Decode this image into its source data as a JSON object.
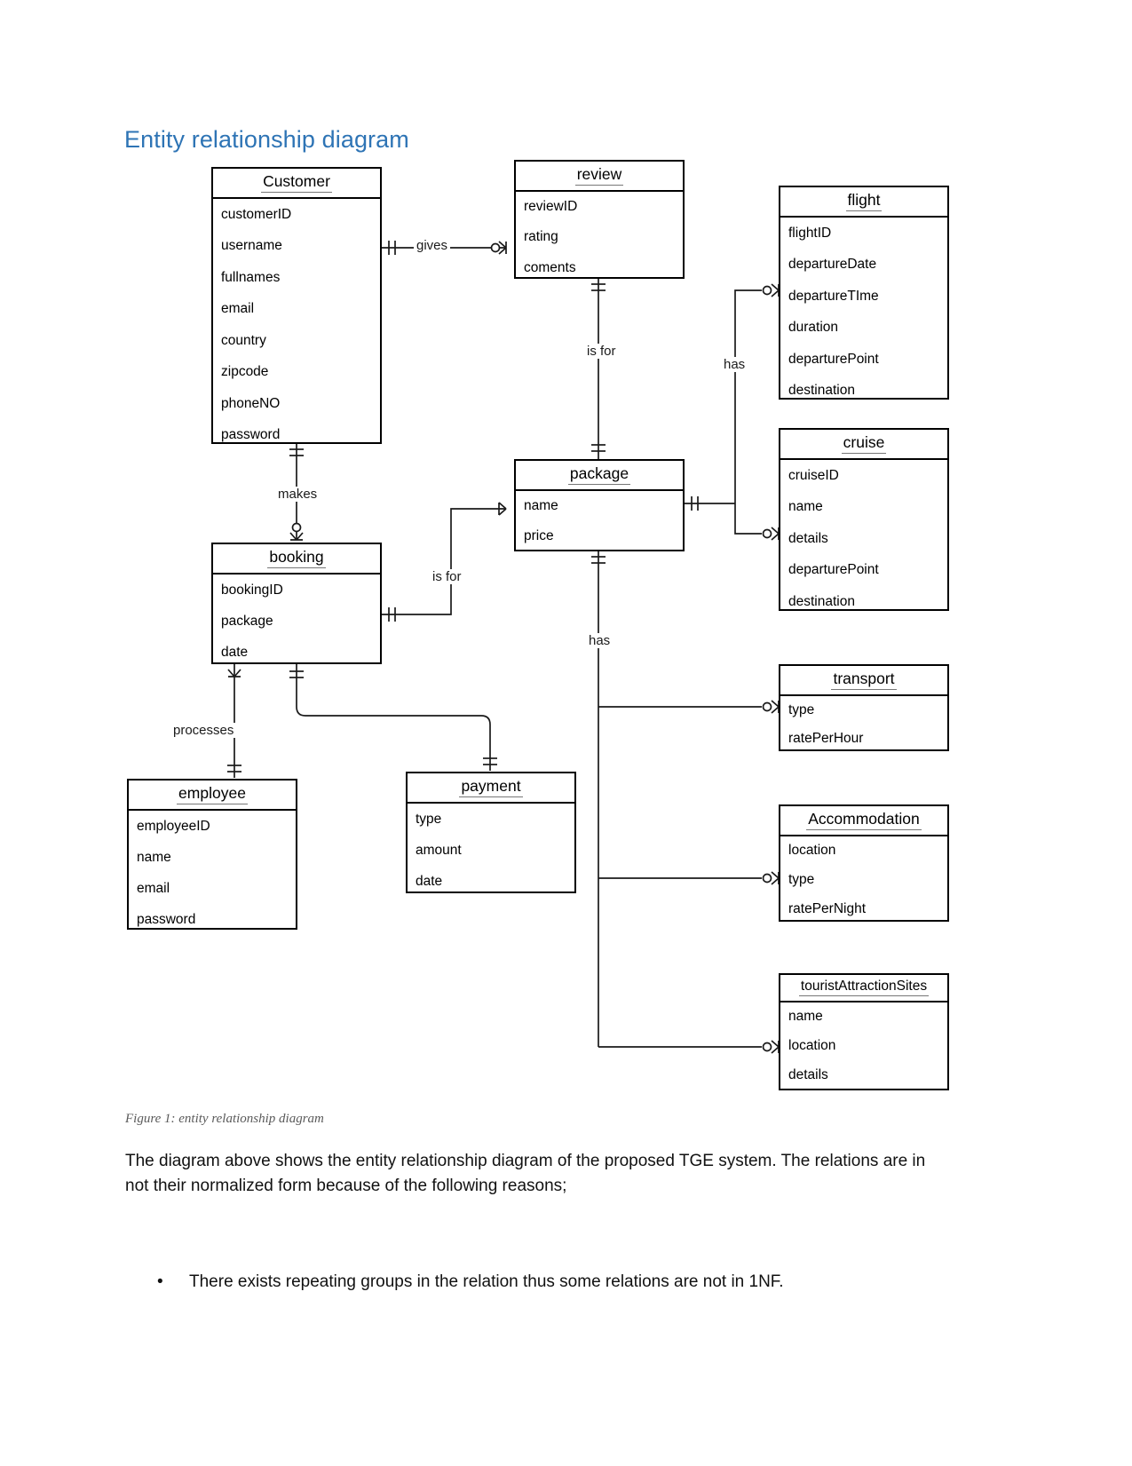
{
  "document": {
    "heading": "Entity relationship diagram",
    "figure_caption": "Figure 1: entity relationship diagram",
    "paragraph": "The diagram above shows the entity relationship diagram of the proposed TGE system. The relations are in not their normalized form because of the following reasons;",
    "bullets": [
      {
        "marker": "•",
        "text": "There exists repeating groups in the relation thus some relations are not in 1NF."
      }
    ],
    "heading_color": "#2E74B5",
    "caption_color": "#5a5a5a"
  },
  "diagram": {
    "type": "entity-relationship",
    "notation": "crows-foot",
    "entities": [
      {
        "id": "customer",
        "title": "Customer",
        "attributes": [
          "customerID",
          "username",
          "fullnames",
          "email",
          "country",
          "zipcode",
          "phoneNO",
          "password"
        ]
      },
      {
        "id": "review",
        "title": "review",
        "attributes": [
          "reviewID",
          "rating",
          "coments"
        ]
      },
      {
        "id": "flight",
        "title": "flight",
        "attributes": [
          "flightID",
          "departureDate",
          "departureTIme",
          "duration",
          "departurePoint",
          "destination"
        ]
      },
      {
        "id": "cruise",
        "title": "cruise",
        "attributes": [
          "cruiseID",
          "name",
          "details",
          "departurePoint",
          "destination"
        ]
      },
      {
        "id": "package",
        "title": "package",
        "attributes": [
          "name",
          "price"
        ]
      },
      {
        "id": "booking",
        "title": "booking",
        "attributes": [
          "bookingID",
          "package",
          "date"
        ]
      },
      {
        "id": "transport",
        "title": "transport",
        "attributes": [
          "type",
          "ratePerHour"
        ]
      },
      {
        "id": "employee",
        "title": "employee",
        "attributes": [
          "employeeID",
          "name",
          "email",
          "password"
        ]
      },
      {
        "id": "payment",
        "title": "payment",
        "attributes": [
          "type",
          "amount",
          "date"
        ]
      },
      {
        "id": "accommodation",
        "title": "Accommodation",
        "attributes": [
          "location",
          "type",
          "ratePerNight"
        ]
      },
      {
        "id": "tourist_attraction_sites",
        "title": "touristAttractionSites",
        "attributes": [
          "name",
          "location",
          "details"
        ]
      }
    ],
    "relationships": [
      {
        "id": "gives",
        "label": "gives",
        "from": "customer",
        "to": "review"
      },
      {
        "id": "is-for-review-package",
        "label": "is for",
        "from": "review",
        "to": "package"
      },
      {
        "id": "has-flight-cruise",
        "label": "has",
        "from": "package",
        "to": "flight"
      },
      {
        "id": "makes",
        "label": "makes",
        "from": "customer",
        "to": "booking"
      },
      {
        "id": "is-for-booking-package",
        "label": "is for",
        "from": "booking",
        "to": "package"
      },
      {
        "id": "has-services",
        "label": "has",
        "from": "package",
        "to": "transport"
      },
      {
        "id": "processes",
        "label": "processes",
        "from": "booking",
        "to": "employee"
      }
    ]
  }
}
